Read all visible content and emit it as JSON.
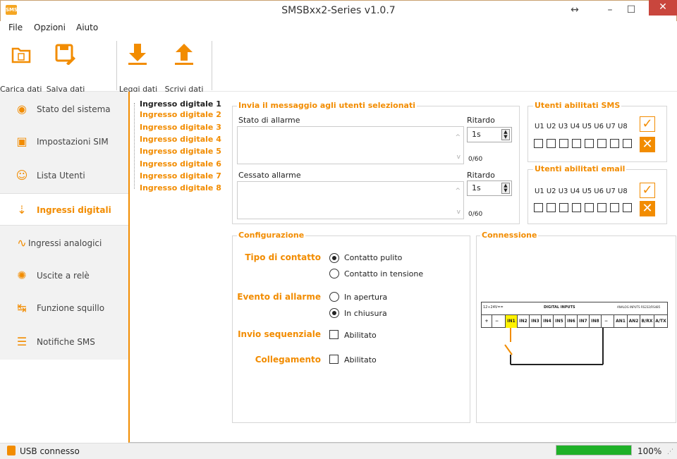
{
  "window": {
    "title": "SMSBxx2-Series v1.0.7",
    "app_icon": "SMS"
  },
  "menu": {
    "items": [
      "File",
      "Opzioni",
      "Aiuto"
    ]
  },
  "toolbar": {
    "load": "Carica dati",
    "save": "Salva dati",
    "read": "Leggi dati",
    "write": "Scrivi dati"
  },
  "sidebar": {
    "items": [
      {
        "label": "Stato del sistema",
        "icon": "eye-icon"
      },
      {
        "label": "Impostazioni SIM",
        "icon": "sim-icon"
      },
      {
        "label": "Lista Utenti",
        "icon": "users-icon"
      },
      {
        "label": "Ingressi digitali",
        "icon": "digital-input-icon"
      },
      {
        "label": "Ingressi analogici",
        "icon": "analog-input-icon"
      },
      {
        "label": "Uscite a relè",
        "icon": "relay-icon"
      },
      {
        "label": "Funzione squillo",
        "icon": "ring-icon"
      },
      {
        "label": "Notifiche SMS",
        "icon": "sms-icon"
      }
    ]
  },
  "inputs_tree": [
    "Ingresso digitale 1",
    "Ingresso digitale 2",
    "Ingresso digitale 3",
    "Ingresso digitale 4",
    "Ingresso digitale 5",
    "Ingresso digitale 6",
    "Ingresso digitale 7",
    "Ingresso digitale 8"
  ],
  "message": {
    "title": "Invia il messaggio agli utenti selezionati",
    "alarm_label": "Stato di allarme",
    "alarm_delay_label": "Ritardo",
    "alarm_delay": "1s",
    "alarm_counter": "0/60",
    "end_label": "Cessato allarme",
    "end_delay_label": "Ritardo",
    "end_delay": "1s",
    "end_counter": "0/60"
  },
  "sms_users": {
    "title": "Utenti abilitati SMS",
    "header": "U1 U2 U3 U4 U5 U6 U7 U8"
  },
  "email_users": {
    "title": "Utenti abilitati email",
    "header": "U1 U2 U3 U4 U5 U6 U7 U8"
  },
  "config": {
    "title": "Configurazione",
    "contact_type": "Tipo di contatto",
    "contact_clean": "Contatto pulito",
    "contact_voltage": "Contatto in tensione",
    "alarm_event": "Evento di allarme",
    "event_open": "In apertura",
    "event_close": "In chiusura",
    "sequential": "Invio sequenziale",
    "sequential_opt": "Abilitato",
    "link": "Collegamento",
    "link_opt": "Abilitato"
  },
  "connection": {
    "title": "Connessione",
    "power": "12÷24V==",
    "digital": "DIGITAL INPUTS",
    "analog": "ANALOG INPUTS",
    "rs": "RS232/RS485",
    "terminals": [
      "+",
      "−",
      "IN1",
      "IN2",
      "IN3",
      "IN4",
      "IN5",
      "IN6",
      "IN7",
      "IN8",
      "−",
      "AN1",
      "AN2",
      "B/RX",
      "A/TX"
    ]
  },
  "status": {
    "text": "USB connesso",
    "progress_pct": "100%",
    "progress": 1.0
  }
}
